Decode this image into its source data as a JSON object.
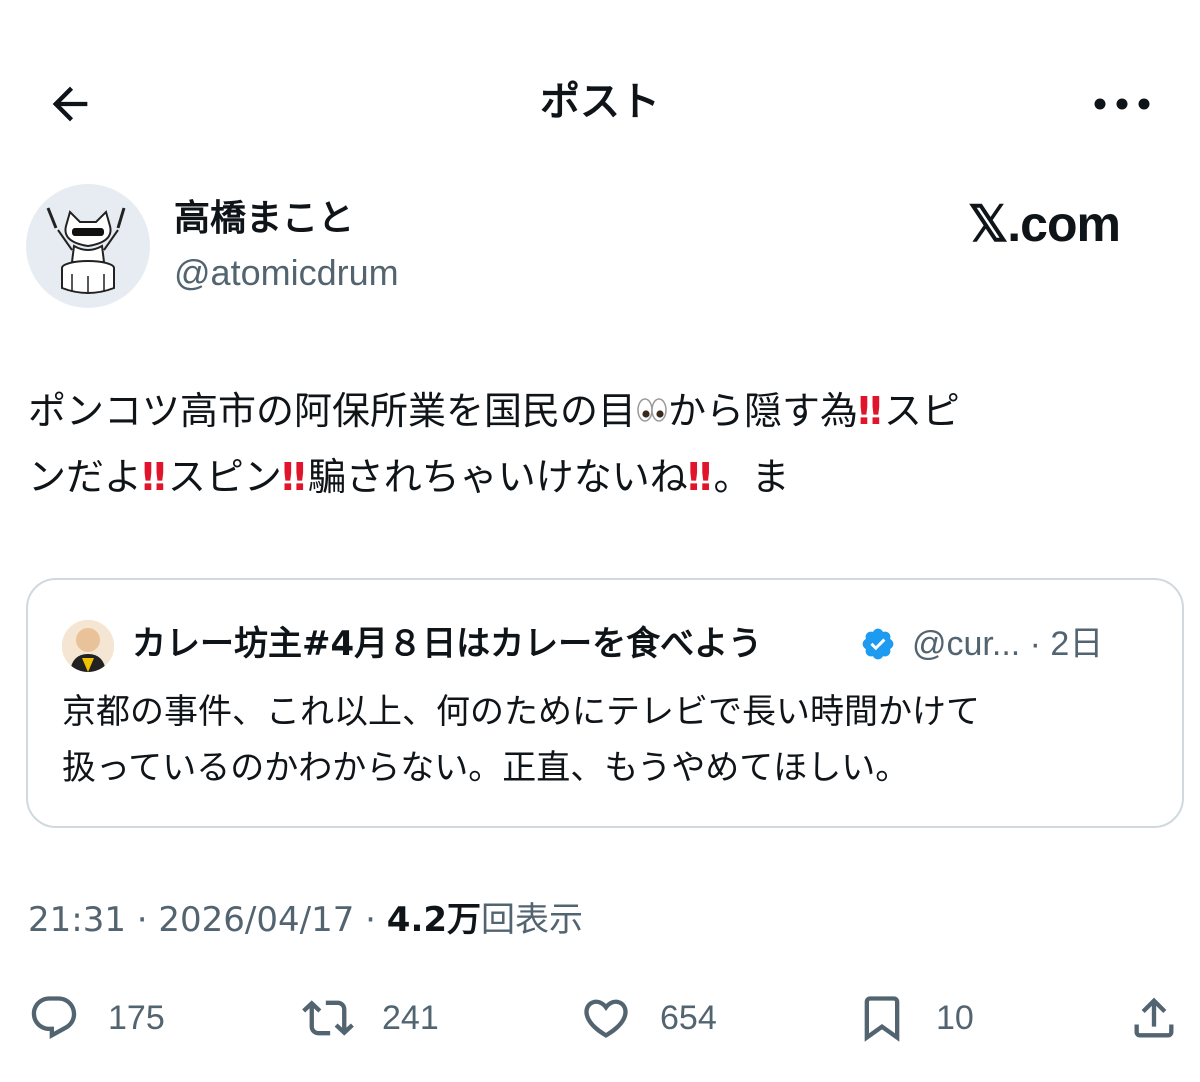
{
  "header": {
    "title": "ポスト",
    "back_icon": "arrow-left-icon",
    "more_icon": "more-horizontal-icon"
  },
  "author": {
    "display_name": "高橋まこと",
    "handle": "@atomicdrum",
    "avatar_icon": "cat-drummer-avatar"
  },
  "brand": {
    "watermark": "𝕏.com"
  },
  "post": {
    "line1_a": "ポンコツ高市の阿保所業を国民の目",
    "line1_b": "から隠す為",
    "line1_c": "スピ",
    "line2_a": "ンだよ",
    "line2_b": "スピン",
    "line2_c": "騙されちゃいけないね",
    "line2_d": "。ま",
    "bang": "‼",
    "eyes_icon": "eyes-emoji"
  },
  "quote": {
    "name": "カレー坊主#4月８日はカレーを食べよう",
    "meta": "@cur... · 2日",
    "text_line1": "京都の事件、これ以上、何のためにテレビで長い時間かけて",
    "text_line2": "扱っているのかわからない。正直、もうやめてほしい。",
    "verified_icon": "verified-badge-icon",
    "avatar_icon": "monk-avatar"
  },
  "meta": {
    "time_date": "21:31 · 2026/04/17 · ",
    "views_count": "4.2万",
    "views_label": "回表示"
  },
  "actions": {
    "reply_count": "175",
    "repost_count": "241",
    "like_count": "654",
    "bookmark_count": "10"
  },
  "colors": {
    "text": "#0f1419",
    "secondary": "#536471",
    "border": "#cfd9de",
    "verified": "#1d9bf0",
    "exclamation": "#e0142b"
  }
}
